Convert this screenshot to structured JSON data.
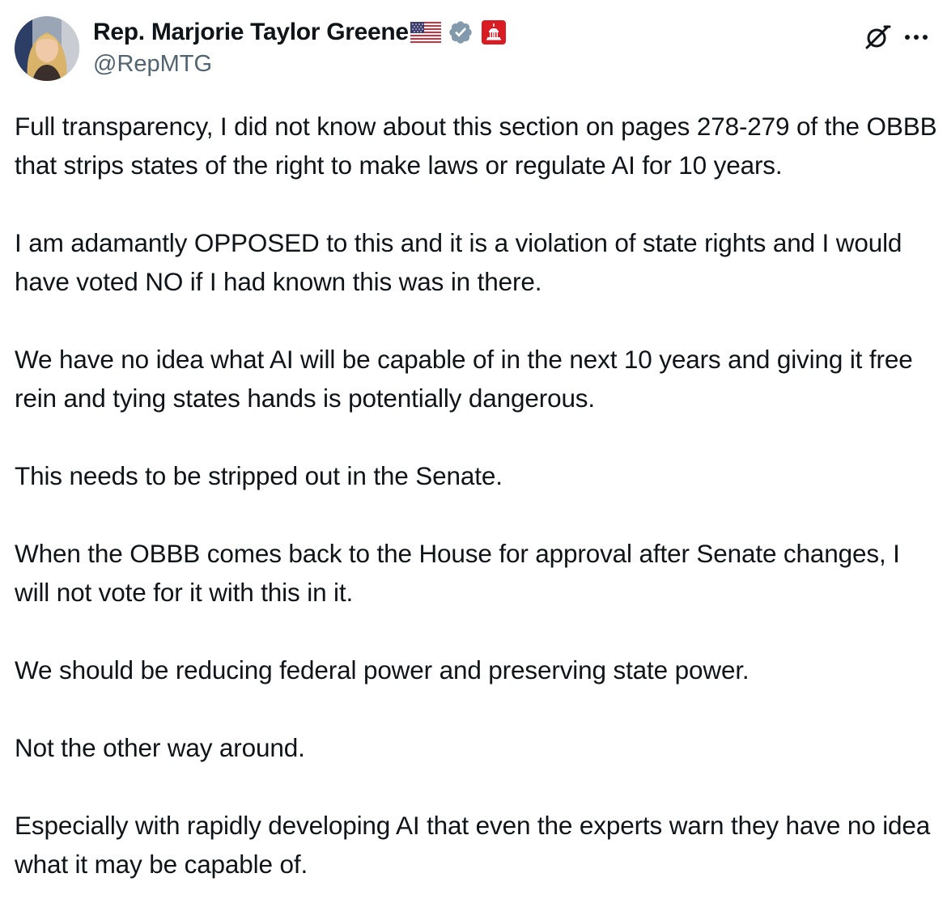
{
  "author": {
    "display_name": "Rep. Marjorie Taylor Greene",
    "handle": "@RepMTG",
    "name_emoji": "us-flag",
    "verified_badge": "gray-verified-badge",
    "affiliation_badge": "us-capitol-badge"
  },
  "actions": {
    "grok_icon": "grok-icon",
    "more_icon": "more-horizontal-icon"
  },
  "colors": {
    "text": "#0f1419",
    "secondary_text": "#536471",
    "verified_gray": "#829aab",
    "affiliation_red": "#d91c24"
  },
  "tweet": {
    "paragraphs": [
      "Full transparency, I did not know about this section on pages 278-279 of the OBBB that strips states of the right to make laws or regulate AI for 10 years.",
      "I am adamantly OPPOSED to this and it is a violation of state rights and I would have voted NO if I had known this was in there.",
      "We have no idea what AI will be capable of in the next 10 years and giving it free rein and tying states hands is potentially dangerous.",
      "This needs to be stripped out in the Senate.",
      "When the OBBB comes back to the House for approval after Senate changes, I will not vote for it with this in it.",
      "We should be reducing federal power and preserving state power.",
      "Not the other way around.",
      "Especially with rapidly developing AI that even the experts warn they have no idea what it may be capable of."
    ]
  }
}
